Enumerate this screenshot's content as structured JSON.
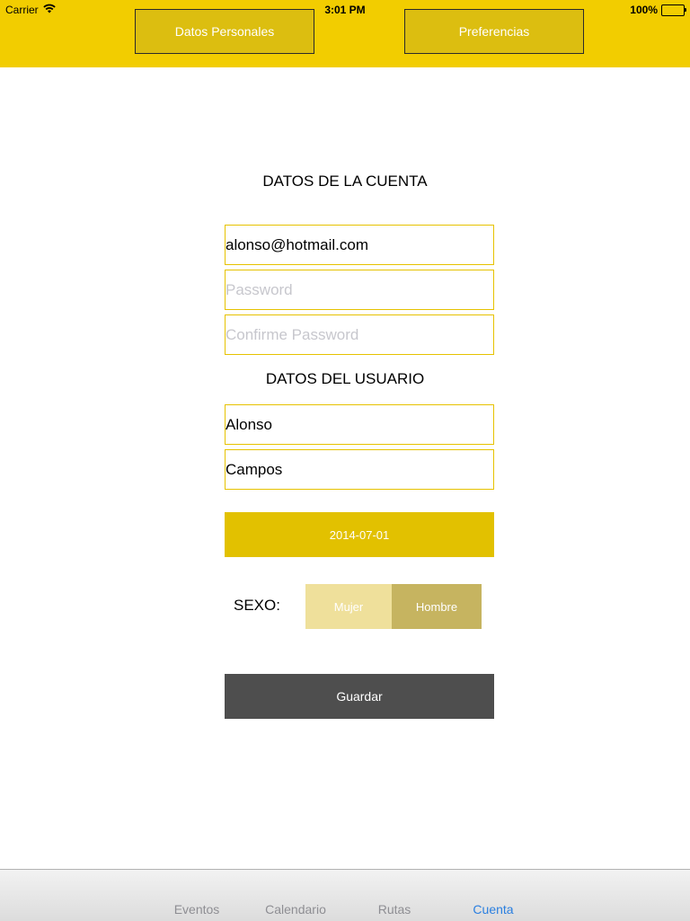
{
  "status_bar": {
    "carrier": "Carrier",
    "time": "3:01 PM",
    "battery": "100%",
    "wifi_icon": "wifi-icon",
    "battery_icon": "battery-icon"
  },
  "header": {
    "tabs": [
      {
        "label": "Datos Personales"
      },
      {
        "label": "Preferencias"
      }
    ],
    "color": "#F2CD00"
  },
  "account_section": {
    "title": "DATOS DE LA CUENTA",
    "email_value": "alonso@hotmail.com",
    "password_placeholder": "Password",
    "confirm_placeholder": "Confirme Password"
  },
  "user_section": {
    "title": "DATOS DEL USUARIO",
    "first_name": "Alonso",
    "last_name": "Campos",
    "birthdate": "2014-07-01"
  },
  "sex": {
    "label": "SEXO:",
    "options": [
      "Mujer",
      "Hombre"
    ],
    "selected": "Hombre"
  },
  "save_button": {
    "label": "Guardar"
  },
  "tab_bar": {
    "items": [
      {
        "label": "Eventos"
      },
      {
        "label": "Calendario"
      },
      {
        "label": "Rutas"
      },
      {
        "label": "Cuenta"
      }
    ],
    "active": "Cuenta",
    "active_color": "#2A7FE0"
  }
}
